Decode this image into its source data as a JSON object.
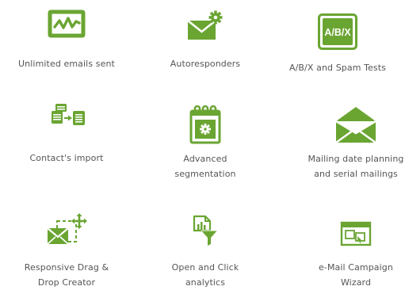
{
  "accent_color": "#6aa532",
  "features": [
    {
      "icon": "activity-chart-icon",
      "label": "Unlimited emails sent"
    },
    {
      "icon": "envelope-gear-icon",
      "label": "Autoresponders"
    },
    {
      "icon": "ab-test-icon",
      "label": "A/B/X and Spam Tests",
      "badge": "A/B/X"
    },
    {
      "icon": "contact-import-icon",
      "label": "Contact's import"
    },
    {
      "icon": "calendar-gear-icon",
      "label": "Advanced\nsegmentation"
    },
    {
      "icon": "open-envelope-icon",
      "label": "Mailing date planning\nand serial mailings"
    },
    {
      "icon": "drag-envelope-icon",
      "label": "Responsive Drag &\nDrop Creator"
    },
    {
      "icon": "analytics-funnel-icon",
      "label": "Open and Click\nanalytics"
    },
    {
      "icon": "campaign-wizard-icon",
      "label": "e-Mail Campaign\nWizard"
    }
  ]
}
